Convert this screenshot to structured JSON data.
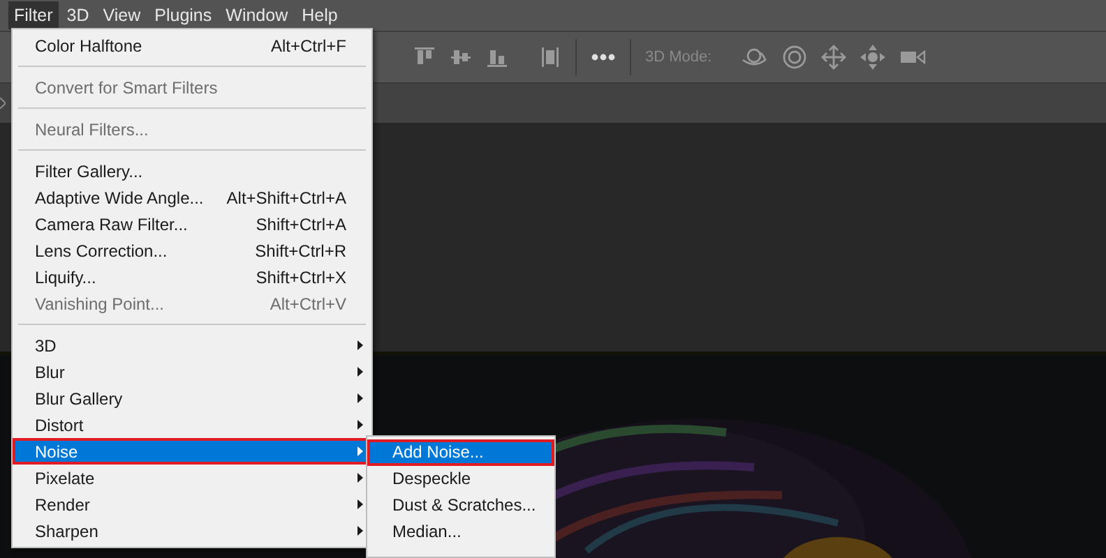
{
  "menu_bar": [
    {
      "label": "Filter",
      "selected": true
    },
    {
      "label": "3D",
      "selected": false
    },
    {
      "label": "View",
      "selected": false
    },
    {
      "label": "Plugins",
      "selected": false
    },
    {
      "label": "Window",
      "selected": false
    },
    {
      "label": "Help",
      "selected": false
    }
  ],
  "options_bar": {
    "mode_label": "3D Mode:"
  },
  "filter_menu": {
    "items": [
      {
        "kind": "item",
        "label": "Color Halftone",
        "shortcut": "Alt+Ctrl+F",
        "disabled": false,
        "selected": false,
        "outlined": false
      },
      {
        "kind": "separator"
      },
      {
        "kind": "item",
        "label": "Convert for Smart Filters",
        "disabled": true,
        "selected": false,
        "outlined": false
      },
      {
        "kind": "separator"
      },
      {
        "kind": "item",
        "label": "Neural Filters...",
        "disabled": true,
        "selected": false,
        "outlined": false
      },
      {
        "kind": "separator"
      },
      {
        "kind": "item",
        "label": "Filter Gallery...",
        "disabled": false,
        "selected": false,
        "outlined": false
      },
      {
        "kind": "item",
        "label": "Adaptive Wide Angle...",
        "shortcut": "Alt+Shift+Ctrl+A",
        "disabled": false,
        "selected": false,
        "outlined": false
      },
      {
        "kind": "item",
        "label": "Camera Raw Filter...",
        "shortcut": "Shift+Ctrl+A",
        "disabled": false,
        "selected": false,
        "outlined": false
      },
      {
        "kind": "item",
        "label": "Lens Correction...",
        "shortcut": "Shift+Ctrl+R",
        "disabled": false,
        "selected": false,
        "outlined": false
      },
      {
        "kind": "item",
        "label": "Liquify...",
        "shortcut": "Shift+Ctrl+X",
        "disabled": false,
        "selected": false,
        "outlined": false
      },
      {
        "kind": "item",
        "label": "Vanishing Point...",
        "shortcut": "Alt+Ctrl+V",
        "disabled": true,
        "selected": false,
        "outlined": false
      },
      {
        "kind": "separator"
      },
      {
        "kind": "submenu",
        "label": "3D",
        "disabled": false,
        "selected": false,
        "outlined": false
      },
      {
        "kind": "submenu",
        "label": "Blur",
        "disabled": false,
        "selected": false,
        "outlined": false
      },
      {
        "kind": "submenu",
        "label": "Blur Gallery",
        "disabled": false,
        "selected": false,
        "outlined": false
      },
      {
        "kind": "submenu",
        "label": "Distort",
        "disabled": false,
        "selected": false,
        "outlined": false
      },
      {
        "kind": "submenu",
        "label": "Noise",
        "disabled": false,
        "selected": true,
        "outlined": true
      },
      {
        "kind": "submenu",
        "label": "Pixelate",
        "disabled": false,
        "selected": false,
        "outlined": false
      },
      {
        "kind": "submenu",
        "label": "Render",
        "disabled": false,
        "selected": false,
        "outlined": false
      },
      {
        "kind": "submenu",
        "label": "Sharpen",
        "disabled": false,
        "selected": false,
        "outlined": false
      }
    ]
  },
  "noise_submenu": {
    "items": [
      {
        "label": "Add Noise...",
        "selected": true,
        "outlined": true
      },
      {
        "label": "Despeckle",
        "selected": false,
        "outlined": false
      },
      {
        "label": "Dust & Scratches...",
        "selected": false,
        "outlined": false
      },
      {
        "label": "Median...",
        "selected": false,
        "outlined": false
      }
    ]
  }
}
